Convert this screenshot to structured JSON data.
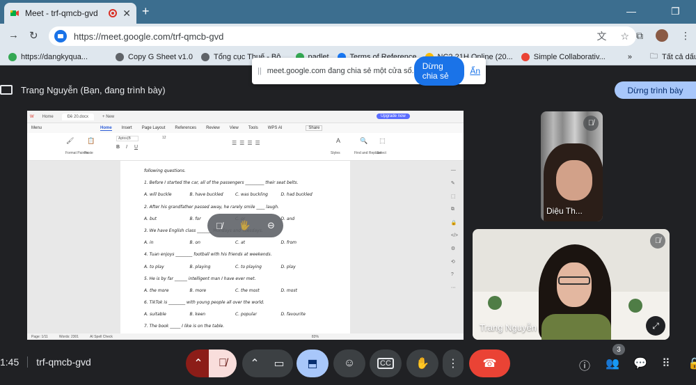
{
  "browser": {
    "tab_title": "Meet - trf-qmcb-gvd",
    "tab_close": "✕",
    "new_tab": "+",
    "url": "https://meet.google.com/trf-qmcb-gvd",
    "bookmarks": [
      {
        "label": "https://dangkyqua...",
        "color": "#34a853"
      },
      {
        "label": "Copy G Sheet v1.0",
        "color": "#5f6368"
      },
      {
        "label": "Tổng cục Thuế - Bộ...",
        "color": "#5f6368"
      },
      {
        "label": "padlet",
        "color": "#34a853"
      },
      {
        "label": "Terms of Reference",
        "color": "#1877f2"
      },
      {
        "label": "NC2 21H Online (20...",
        "color": "#fbbc04"
      },
      {
        "label": "Simple Collaborativ...",
        "color": "#ea4335"
      }
    ],
    "bookmarks_more": "»",
    "all_bookmarks": "Tất cả dấu tr"
  },
  "share_popup": {
    "message": "meet.google.com đang chia sẻ một cửa sổ.",
    "stop_label": "Dừng chia sẻ",
    "hide_label": "Ẩn"
  },
  "presenting": {
    "label": "Trang Nguyễn (Bạn, đang trình bày)",
    "stop_label": "Dừng trình bày"
  },
  "wps": {
    "tabs": [
      "Home",
      "Đề 20.docx",
      "New"
    ],
    "upgrade": "Upgrade now",
    "menu": [
      "Menu",
      "Home",
      "Insert",
      "Page Layout",
      "References",
      "Review",
      "View",
      "Tools",
      "WPS AI"
    ],
    "share": "Share",
    "ribbon": {
      "format_painter": "Format Painter",
      "paste": "Paste",
      "font": "Aptos(B",
      "size": "12",
      "styles": "Styles",
      "find_replace": "Find and Replace",
      "select": "Select"
    },
    "status": {
      "page": "Page: 1/11",
      "words": "Words: 2301",
      "spell": "AI Spell Check",
      "zoom": "83%"
    },
    "lines": [
      {
        "text": "following questions."
      },
      {
        "text": "1. Before I started the car, all of the passengers _________ their seat belts."
      },
      {
        "opts": [
          "A. will buckle",
          "B. have buckled",
          "C. was buckling",
          "D. had buckled"
        ]
      },
      {
        "text": "2. After his grandfather passed away, he rarely smile ____ laugh."
      },
      {
        "opts": [
          "A. but",
          "B. for",
          "C. or",
          "D. and"
        ]
      },
      {
        "text": "3. We have English class _______ Mondays and Tuesdays."
      },
      {
        "opts": [
          "A. in",
          "B. on",
          "C. at",
          "D. from"
        ]
      },
      {
        "text": "4. Tuan enjoys ________ football with his friends at weekends."
      },
      {
        "opts": [
          "A. to play",
          "B. playing",
          "C. to playing",
          "D. play"
        ]
      },
      {
        "text": "5. He is by far ______ intelligent man I have ever met."
      },
      {
        "opts": [
          "A. the more",
          "B. more",
          "C. the most",
          "D. most"
        ]
      },
      {
        "text": "6. TikTok is ________ with young people all over the world."
      },
      {
        "opts": [
          "A. suitable",
          "B. keen",
          "C. popular",
          "D. favourite"
        ]
      },
      {
        "text": "7. The book _____ I like is on the table."
      }
    ]
  },
  "participants": [
    {
      "name": "Diệu Th..."
    },
    {
      "name": "Trang Nguyễn"
    }
  ],
  "meeting": {
    "time": "1:45",
    "code": "trf-qmcb-gvd",
    "people_count": "3"
  },
  "colors": {
    "meet_bg": "#202124",
    "accent": "#a8c7fa",
    "end_call": "#ea4335",
    "share_stop": "#1a73e8"
  }
}
